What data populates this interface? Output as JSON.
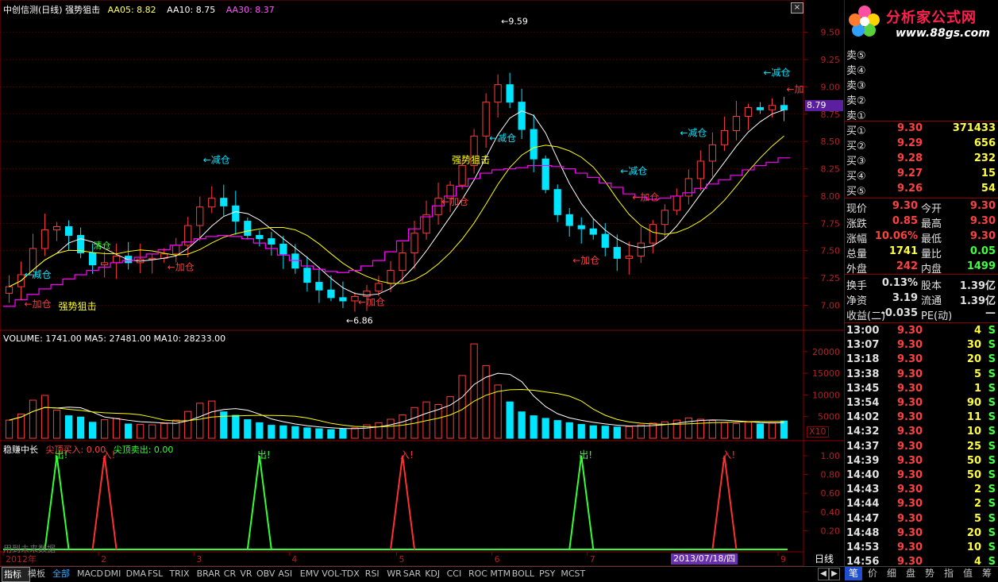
{
  "header": {
    "title": "中创信测(日线) 强势狙击",
    "aa05": "AA05: 8.82",
    "aa10": "AA10: 8.75",
    "aa30": "AA30: 8.37"
  },
  "logo": {
    "title": "分析家公式网",
    "url": "www.88gs.com"
  },
  "price_axis": [
    "9.50",
    "9.25",
    "9.00",
    "8.75",
    "8.50",
    "8.25",
    "8.00",
    "7.75",
    "7.50",
    "7.25",
    "7.00"
  ],
  "current_price_tag": "8.79",
  "annotations": {
    "high": "9.59",
    "low": "6.86",
    "jiancang": "减仓",
    "jiacang": "加仓",
    "qiangshi": "强势狙击",
    "jian_arrow": "←减仓",
    "jia_arrow": "←加仓",
    "jia_short": "←加",
    "qingcang": "清仓"
  },
  "volume": {
    "header": "VOLUME: 1741.00  MA5: 27481.00  MA10: 28233.00",
    "axis": [
      "20000",
      "15000",
      "10000",
      "5000"
    ],
    "unit": "X10"
  },
  "indicator": {
    "name": "稳赚中长",
    "buy": "尖顶买入: 0.00",
    "sell": "尖顶卖出: 0.00",
    "axis": [
      "1.00",
      "0.80",
      "0.60",
      "0.40",
      "0.20"
    ],
    "out_label": "出!",
    "in_label": "入!",
    "footer_text": "用到未来数据"
  },
  "x_axis": {
    "labels": [
      "2012年",
      "2",
      "3",
      "4",
      "5",
      "6",
      "7",
      "8",
      "9"
    ],
    "date_box": "2013/07/18/四"
  },
  "orderbook": {
    "sell": [
      {
        "label": "卖⑤"
      },
      {
        "label": "卖④"
      },
      {
        "label": "卖③"
      },
      {
        "label": "卖②"
      },
      {
        "label": "卖①"
      }
    ],
    "buy": [
      {
        "label": "买①",
        "price": "9.30",
        "vol": "371433"
      },
      {
        "label": "买②",
        "price": "9.29",
        "vol": "656"
      },
      {
        "label": "买③",
        "price": "9.28",
        "vol": "232"
      },
      {
        "label": "买④",
        "price": "9.27",
        "vol": "15"
      },
      {
        "label": "买⑤",
        "price": "9.26",
        "vol": "54"
      }
    ]
  },
  "quote": [
    {
      "l1": "现价",
      "v1": "9.30",
      "l2": "今开",
      "v2": "9.30"
    },
    {
      "l1": "涨跌",
      "v1": "0.85",
      "l2": "最高",
      "v2": "9.30"
    },
    {
      "l1": "涨幅",
      "v1": "10.06%",
      "l2": "最低",
      "v2": "9.30"
    },
    {
      "l1": "总量",
      "v1": "1741",
      "l2": "量比",
      "v2": "0.05"
    },
    {
      "l1": "外盘",
      "v1": "242",
      "l2": "内盘",
      "v2": "1499"
    },
    {
      "l1": "换手",
      "v1": "0.13%",
      "l2": "股本",
      "v2": "1.39亿"
    },
    {
      "l1": "净资",
      "v1": "3.19",
      "l2": "流通",
      "v2": "1.39亿"
    },
    {
      "l1": "收益(二)",
      "v1": "-0.035",
      "l2": "PE(动)",
      "v2": "—"
    }
  ],
  "ticks": [
    {
      "time": "13:00",
      "price": "9.30",
      "vol": "4",
      "side": "S"
    },
    {
      "time": "13:07",
      "price": "9.30",
      "vol": "30",
      "side": "S"
    },
    {
      "time": "13:18",
      "price": "9.30",
      "vol": "20",
      "side": "S"
    },
    {
      "time": "13:38",
      "price": "9.30",
      "vol": "5",
      "side": "S"
    },
    {
      "time": "13:45",
      "price": "9.30",
      "vol": "1",
      "side": "S"
    },
    {
      "time": "13:54",
      "price": "9.30",
      "vol": "90",
      "side": "S"
    },
    {
      "time": "14:02",
      "price": "9.30",
      "vol": "11",
      "side": "S"
    },
    {
      "time": "14:32",
      "price": "9.30",
      "vol": "10",
      "side": "S"
    },
    {
      "time": "14:37",
      "price": "9.30",
      "vol": "25",
      "side": "S"
    },
    {
      "time": "14:39",
      "price": "9.30",
      "vol": "50",
      "side": "S"
    },
    {
      "time": "14:40",
      "price": "9.30",
      "vol": "50",
      "side": "S"
    },
    {
      "time": "14:43",
      "price": "9.30",
      "vol": "2",
      "side": "S"
    },
    {
      "time": "14:44",
      "price": "9.30",
      "vol": "2",
      "side": "S"
    },
    {
      "time": "14:47",
      "price": "9.30",
      "vol": "5",
      "side": "S"
    },
    {
      "time": "14:48",
      "price": "9.30",
      "vol": "20",
      "side": "S"
    },
    {
      "time": "14:53",
      "price": "9.30",
      "vol": "10",
      "side": "S"
    },
    {
      "time": "14:56",
      "price": "9.30",
      "vol": "4",
      "side": "S"
    }
  ],
  "bottom_tabs": [
    "指标",
    "模板",
    "全部",
    "MACD",
    "DMI",
    "DMA",
    "FSL",
    "TRIX",
    "BRAR",
    "CR",
    "VR",
    "OBV",
    "ASI",
    "EMV",
    "VOL-TDX",
    "RSI",
    "WR",
    "SAR",
    "KDJ",
    "CCI",
    "ROC",
    "MTM",
    "BOLL",
    "PSY",
    "MCST"
  ],
  "period_label": "日线",
  "right_tabs": [
    "笔",
    "价",
    "细",
    "盘",
    "势",
    "指",
    "值",
    "筹"
  ],
  "colors": {
    "up": "#ff3b3b",
    "down": "#00e5ff",
    "ma5": "#ffffff",
    "ma10": "#ffff00",
    "ma30": "#ff00ff",
    "grid": "#8b0000",
    "label": "#c0c0c0",
    "yellow": "#ffff00",
    "green": "#00ff00"
  },
  "chart_data": {
    "type": "candlestick",
    "ylim": [
      6.8,
      9.65
    ],
    "open": [
      7.11,
      7.17,
      7.28,
      7.52,
      7.69,
      7.72,
      7.64,
      7.48,
      7.37,
      7.39,
      7.45,
      7.39,
      7.42,
      7.43,
      7.47,
      7.55,
      7.73,
      7.9,
      7.98,
      7.91,
      7.77,
      7.64,
      7.61,
      7.56,
      7.47,
      7.34,
      7.21,
      7.14,
      7.07,
      7.04,
      7.08,
      7.13,
      7.2,
      7.32,
      7.48,
      7.66,
      7.83,
      7.98,
      8.1,
      8.28,
      8.55,
      8.86,
      9.02,
      8.86,
      8.61,
      8.34,
      8.06,
      7.83,
      7.73,
      7.7,
      7.65,
      7.53,
      7.43,
      7.45,
      7.57,
      7.74,
      7.87,
      8.0,
      8.16,
      8.32,
      8.47,
      8.6,
      8.73,
      8.81,
      8.79,
      8.83
    ],
    "close": [
      7.17,
      7.28,
      7.52,
      7.69,
      7.72,
      7.64,
      7.48,
      7.37,
      7.39,
      7.45,
      7.39,
      7.42,
      7.43,
      7.47,
      7.55,
      7.73,
      7.9,
      7.98,
      7.91,
      7.77,
      7.64,
      7.61,
      7.56,
      7.47,
      7.34,
      7.21,
      7.14,
      7.07,
      7.04,
      7.08,
      7.13,
      7.2,
      7.32,
      7.48,
      7.66,
      7.83,
      7.98,
      8.1,
      8.28,
      8.55,
      8.86,
      9.02,
      8.86,
      8.61,
      8.34,
      8.06,
      7.83,
      7.73,
      7.7,
      7.65,
      7.53,
      7.43,
      7.45,
      7.57,
      7.74,
      7.87,
      8.0,
      8.16,
      8.32,
      8.47,
      8.6,
      8.73,
      8.81,
      8.79,
      8.83,
      8.79
    ],
    "ma30": [
      6.99,
      7.05,
      7.1,
      7.15,
      7.19,
      7.24,
      7.28,
      7.32,
      7.35,
      7.39,
      7.41,
      7.44,
      7.47,
      7.51,
      7.55,
      7.58,
      7.61,
      7.63,
      7.64,
      7.63,
      7.61,
      7.57,
      7.52,
      7.46,
      7.41,
      7.36,
      7.33,
      7.31,
      7.3,
      7.32,
      7.36,
      7.41,
      7.49,
      7.59,
      7.7,
      7.81,
      7.91,
      8.0,
      8.09,
      8.16,
      8.21,
      8.24,
      8.25,
      8.26,
      8.28,
      8.28,
      8.27,
      8.25,
      8.21,
      8.17,
      8.12,
      8.08,
      8.02,
      7.99,
      7.97,
      7.98,
      8.0,
      8.03,
      8.07,
      8.11,
      8.15,
      8.19,
      8.24,
      8.28,
      8.31,
      8.35
    ],
    "volume": [
      4200,
      5600,
      8800,
      9900,
      6500,
      5200,
      4900,
      3700,
      4300,
      4600,
      3300,
      3200,
      3100,
      3400,
      4200,
      6200,
      8100,
      8600,
      6100,
      5300,
      4300,
      3600,
      3000,
      2900,
      2700,
      2400,
      2200,
      2000,
      2100,
      2400,
      3100,
      3600,
      4400,
      5400,
      7100,
      8400,
      7800,
      9600,
      14500,
      21800,
      16800,
      12300,
      8400,
      6100,
      5200,
      4600,
      4100,
      3600,
      3200,
      2900,
      2800,
      2600,
      2700,
      3100,
      3500,
      3800,
      4200,
      4700,
      4400,
      4100,
      3600,
      3400,
      3700,
      3300,
      3600,
      4000
    ],
    "ind_out": [
      4,
      21,
      48
    ],
    "ind_in": [
      8,
      33,
      60
    ]
  }
}
